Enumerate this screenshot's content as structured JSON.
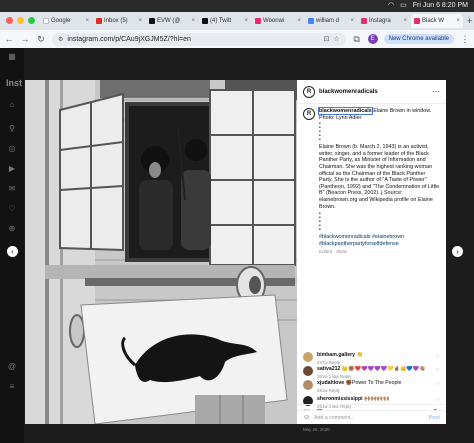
{
  "menubar": {
    "datetime": "Fri Jun 6  8:20 PM"
  },
  "browser": {
    "tabs": [
      {
        "label": "Google",
        "color": "#ffffff"
      },
      {
        "label": "Inbox (5)",
        "color": "#d93025"
      },
      {
        "label": "EVW (@",
        "color": "#111111"
      },
      {
        "label": "(4) Twitt",
        "color": "#111111"
      },
      {
        "label": "Woonwi",
        "color": "#e1306c"
      },
      {
        "label": "william d",
        "color": "#4285f4"
      },
      {
        "label": "Instagra",
        "color": "#e1306c"
      },
      {
        "label": "Black W",
        "color": "#e1306c",
        "active": true
      }
    ],
    "url": "instagram.com/p/CAu9jXGJM5Z/?hl=en",
    "new_chrome_label": "New Chrome available",
    "profile_initial": "E"
  },
  "instagram": {
    "logo_text": "Inst"
  },
  "post": {
    "username": "blackwomenradicals",
    "avatar_letter": "R",
    "caption_lead": " Elaine Brown in window. Photo: Lynn Adler.",
    "caption_body": "Elaine Brown (b. March 2, 1943) is an activist, writer, singer, and a former leader of the Black Panther Party, as Minister of Information and Chairman. She was the highest ranking woman official as the Chairman of the Black Panther Party. She is the author of \"A Taste of Power\" (Pantheon, 1992) and \"The Condemnation of Little B\" (Beacon Press, 2002). | Source: elainebrown.org and Wikipedia profile on Elaine Brown.",
    "hashtags": "#blackwomenradicals #elainebrown #blackpantherpartyforselfdefense",
    "caption_meta": "Edited · 262w",
    "comments": [
      {
        "user": "bimbam.gallery",
        "text": " 👏",
        "meta": "247w   Reply",
        "color": "#c9a56b"
      },
      {
        "user": "sativa212",
        "text": " 👑✊🏽❤️💜💜💜💜💛🤞🏽👑💙💜👋🏽",
        "meta": "261w   1 like   Reply",
        "color": "#6b4a3a"
      },
      {
        "user": "xjudahlove",
        "text": " ✊🏾Power To The People",
        "meta": "261w   Reply",
        "color": "#b08c6a"
      },
      {
        "user": "sheronmississippi",
        "text": " 🙌🏽🙌🏽🙌🏽🙌🏽",
        "meta": "261w   1 like   Reply",
        "color": "#222222"
      }
    ],
    "liked_by": "Liked by natonya_1983 and others",
    "date": "May 28, 2020",
    "add_comment_placeholder": "Add a comment...",
    "post_button": "Post"
  }
}
